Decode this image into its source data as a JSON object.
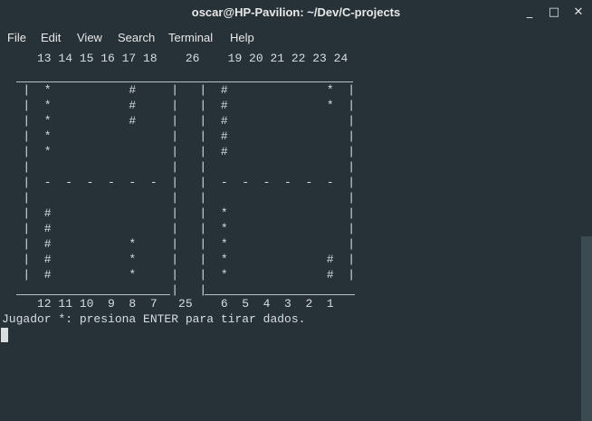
{
  "window": {
    "title": "oscar@HP-Pavilion: ~/Dev/C-projects",
    "controls": {
      "minimize": "_",
      "maximize": "□",
      "close": "✕"
    }
  },
  "menubar": {
    "items": [
      "File",
      "Edit",
      "View",
      "Search",
      "Terminal",
      "Help"
    ]
  },
  "terminal": {
    "lines": [
      "     13 14 15 16 17 18    26    19 20 21 22 23 24",
      "",
      "   |  *           #     |   |  #              *  |",
      "   |  *           #     |   |  #              *  |",
      "   |  *           #     |   |  #                 |",
      "   |  *                 |   |  #                 |",
      "   |  *                 |   |  #                 |",
      "   |                    |   |                    |",
      "   |  -  -  -  -  -  -  |   |  -  -  -  -  -  -  |",
      "   |                    |   |                    |",
      "   |  #                 |   |  *                 |",
      "   |  #                 |   |  *                 |",
      "   |  #           *     |   |  *                 |",
      "   |  #           *     |   |  *              #  |",
      "   |  #           *     |   |  *              #  |",
      "                        |   |",
      "     12 11 10  9  8  7   25    6  5  4  3  2  1",
      "Jugador *: presiona ENTER para tirar dados."
    ]
  },
  "colors": {
    "background": "#263238",
    "text": "#d8dde0",
    "scrollbar_thumb": "#3c4a51"
  }
}
